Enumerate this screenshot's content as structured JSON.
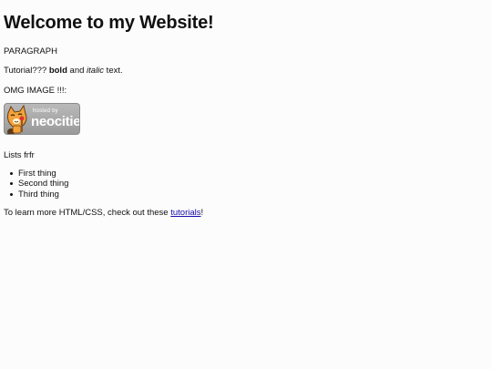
{
  "heading": "Welcome to my Website!",
  "paragraph_label": "PARAGRAPH",
  "tutorial_line": {
    "prefix": "Tutorial??? ",
    "bold": "bold",
    "middle": " and ",
    "italic": "italic",
    "suffix": " text."
  },
  "image_label": "OMG IMAGE !!!:",
  "logo": {
    "small_text": "hosted by",
    "brand": "neocities"
  },
  "lists_label": "Lists frfr",
  "list_items": [
    "First thing",
    "Second thing",
    "Third thing"
  ],
  "learn_line": {
    "prefix": "To learn more HTML/CSS, check out these ",
    "link": "tutorials",
    "suffix": "!"
  }
}
